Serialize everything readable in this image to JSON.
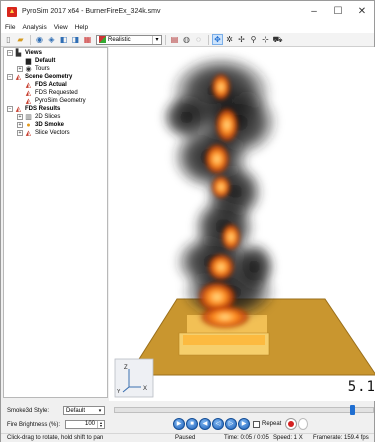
{
  "window": {
    "title": "PyroSim 2017 x64 - BurnerFireEx_324k.smv",
    "minimize": "–",
    "maximize": "☐",
    "close": "✕"
  },
  "menu": [
    "File",
    "Analysis",
    "View",
    "Help"
  ],
  "toolbar": {
    "render_mode": "Realistic"
  },
  "tree": {
    "views": "Views",
    "default": "Default",
    "tours": "Tours",
    "scene_geometry": "Scene Geometry",
    "fds_actual": "FDS Actual",
    "fds_requested": "FDS Requested",
    "pyrosim_geometry": "PyroSim Geometry",
    "fds_results": "FDS Results",
    "slices_2d": "2D Slices",
    "smoke_3d": "3D Smoke",
    "slice_vectors": "Slice Vectors"
  },
  "viewport": {
    "time_overlay": "5.1",
    "axis_z": "Z",
    "axis_x": "X",
    "axis_y": "Y"
  },
  "controls": {
    "smoke_style_label": "Smoke3d Style:",
    "smoke_style_value": "Default",
    "fire_brightness_label": "Fire Brightness (%):",
    "fire_brightness_value": "100",
    "repeat_label": "Repeat",
    "timeline_position": 0.93
  },
  "status": {
    "hint": "Click-drag to rotate, hold shift to pan",
    "state": "Paused",
    "time": "Time: 0:05 / 0:05",
    "speed": "Speed: 1 X",
    "framerate": "Framerate: 159.4 fps"
  },
  "colors": {
    "accent": "#1f6ed1",
    "floor": "#c9962f",
    "burner": "#f3c35a",
    "flame": "#ff7a10",
    "smoke": "#1a1a1a"
  },
  "icons": {
    "toolbar": [
      "new-file-icon",
      "open-icon",
      "save-icon",
      "copy-icon",
      "paste-icon",
      "print-icon",
      "render-mode-icon",
      "grid-icon",
      "shading-icon",
      "select-icon",
      "orbit-icon",
      "pan-icon",
      "zoom-icon",
      "fly-icon",
      "camera-icon"
    ]
  }
}
